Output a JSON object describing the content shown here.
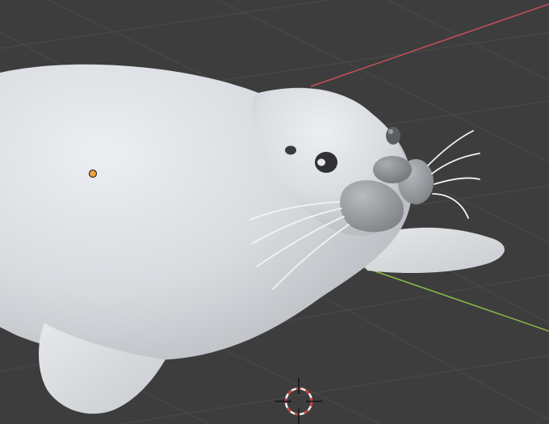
{
  "viewport": {
    "background": "#3d3d3d",
    "grid_color": "#4a4a4a",
    "axes": {
      "x_axis_color": "#c4505b",
      "y_axis_color": "#8bbb4a"
    },
    "scene_object": "seal-mesh",
    "object_origin_color": "#f0a53b",
    "cursor_colors": [
      "#d63a3a",
      "#f2f2f2"
    ]
  }
}
